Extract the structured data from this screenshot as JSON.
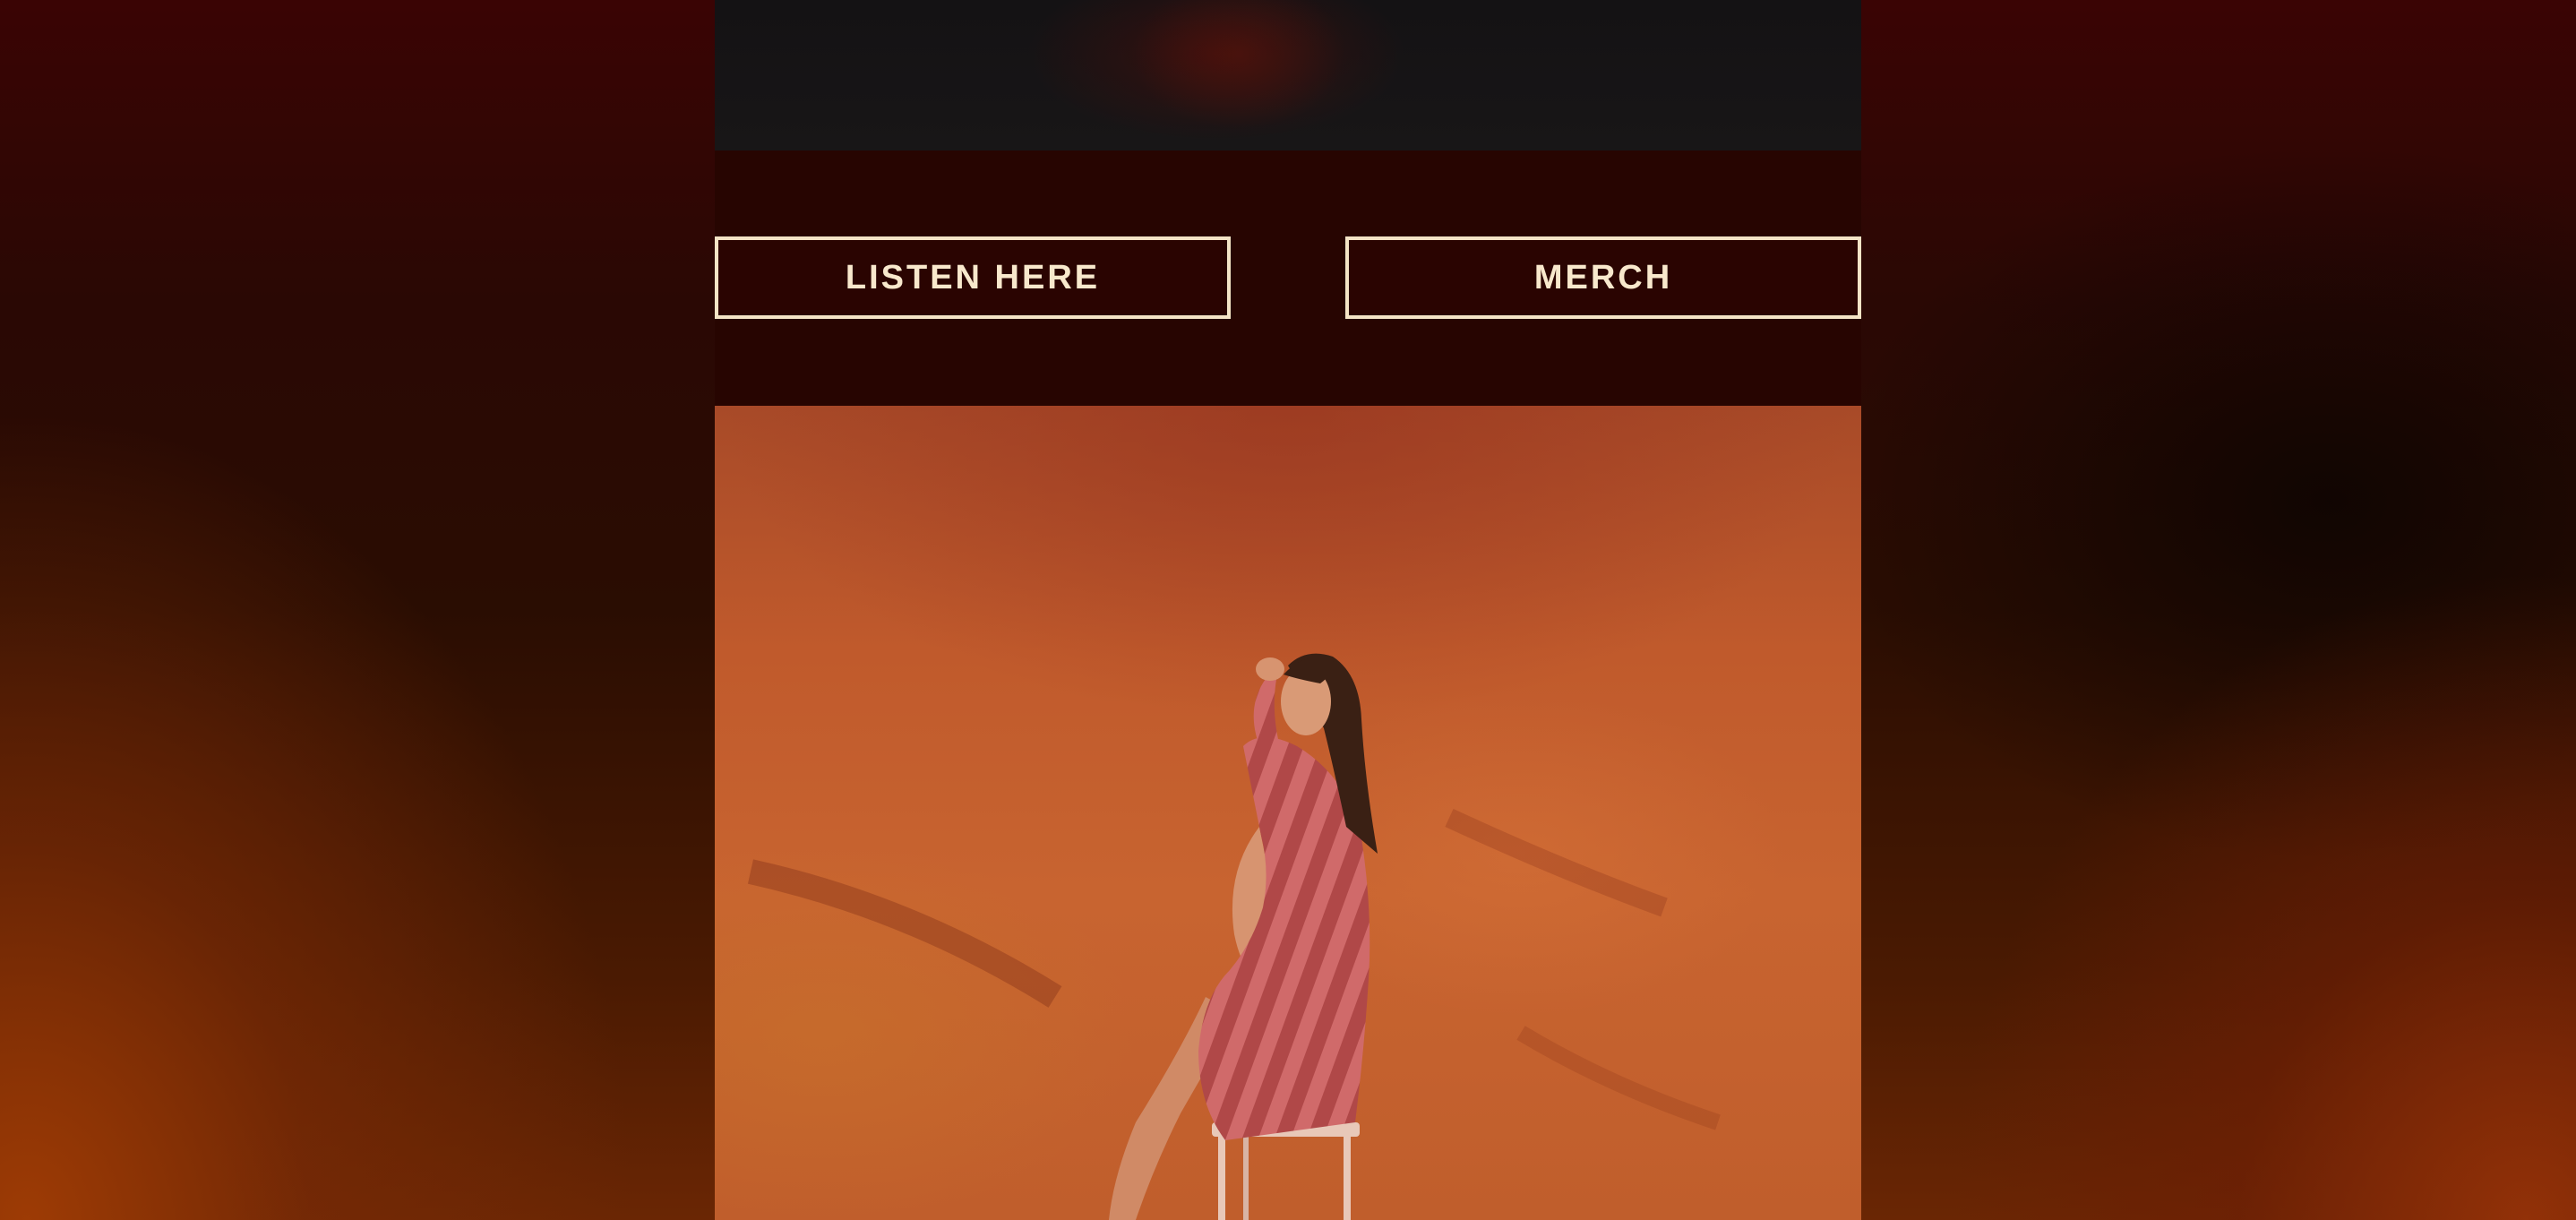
{
  "buttons": {
    "listen_label": "LISTEN HERE",
    "merch_label": "MERCH"
  },
  "colors": {
    "button_border": "#f4e4c6",
    "button_text": "#f8e8cc",
    "column_background": "#270501",
    "photo_backdrop": "#c05a2c"
  },
  "images": {
    "top_image": "dark-photo-crop",
    "main_photo": "woman-in-striped-dress-on-stool"
  }
}
